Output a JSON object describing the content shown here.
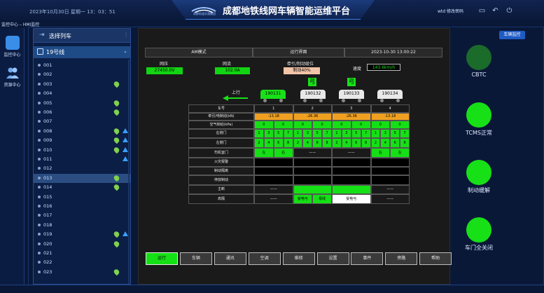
{
  "header": {
    "datetime": "2023年10月30日 星期一 13：03：51",
    "logo_text": "成都轨道交通集团",
    "title": "成都地铁线网车辆智能运维平台",
    "user": "wtd 修改密码"
  },
  "breadcrumb": "监控中心 – HMI监控",
  "rail": [
    {
      "label": "监控中心",
      "icon": "monitor-icon"
    },
    {
      "label": "资源中心",
      "icon": "users-icon"
    }
  ],
  "list": {
    "title": "选择列车",
    "group": "19号线",
    "trains": [
      {
        "id": "001",
        "pin": false,
        "warn": false
      },
      {
        "id": "002",
        "pin": false,
        "warn": false
      },
      {
        "id": "003",
        "pin": true,
        "warn": false
      },
      {
        "id": "004",
        "pin": false,
        "warn": false
      },
      {
        "id": "005",
        "pin": true,
        "warn": false
      },
      {
        "id": "006",
        "pin": true,
        "warn": false
      },
      {
        "id": "007",
        "pin": false,
        "warn": false
      },
      {
        "id": "008",
        "pin": true,
        "warn": true
      },
      {
        "id": "009",
        "pin": true,
        "warn": true
      },
      {
        "id": "010",
        "pin": true,
        "warn": true
      },
      {
        "id": "011",
        "pin": false,
        "warn": true
      },
      {
        "id": "012",
        "pin": false,
        "warn": false
      },
      {
        "id": "013",
        "pin": true,
        "warn": false,
        "selected": true
      },
      {
        "id": "014",
        "pin": true,
        "warn": false
      },
      {
        "id": "015",
        "pin": false,
        "warn": false
      },
      {
        "id": "016",
        "pin": false,
        "warn": false
      },
      {
        "id": "017",
        "pin": false,
        "warn": false
      },
      {
        "id": "018",
        "pin": false,
        "warn": false
      },
      {
        "id": "019",
        "pin": true,
        "warn": true
      },
      {
        "id": "020",
        "pin": true,
        "warn": false
      },
      {
        "id": "021",
        "pin": false,
        "warn": false
      },
      {
        "id": "022",
        "pin": false,
        "warn": false
      },
      {
        "id": "023",
        "pin": true,
        "warn": false
      }
    ]
  },
  "hmi": {
    "mode": "AM模式",
    "screen": "运行界面",
    "time": "2023-10-30 13:00:22",
    "net_voltage_label": "网压",
    "net_voltage": "27450.0V",
    "net_current_label": "网流",
    "net_current": "102.0A",
    "traction_label": "牵引/制动级位",
    "traction_value": "制动40%",
    "speed_label": "速度",
    "speed": "143.6km/h",
    "direction": "上行",
    "cars": [
      "190131",
      "190132",
      "190133",
      "190134"
    ],
    "pantograph": [
      "弓",
      "弓"
    ],
    "rows": [
      {
        "label": "车号",
        "cells": [
          "1",
          "2",
          "3",
          "4"
        ]
      },
      {
        "label": "牵引/电制动(kN)",
        "cells": [
          "-13.18",
          "-26.36",
          "-26.36",
          "-13.18"
        ]
      },
      {
        "label": "空气制动(kPa)",
        "cells": [
          "0",
          "0",
          "0",
          "0",
          "0",
          "0",
          "0",
          "0"
        ]
      },
      {
        "label": "右侧门",
        "cells": [
          "1",
          "3",
          "5",
          "7",
          "1",
          "3",
          "5",
          "7",
          "1",
          "3",
          "5",
          "7",
          "1",
          "3",
          "5",
          "7"
        ]
      },
      {
        "label": "左侧门",
        "cells": [
          "2",
          "4",
          "6",
          "8",
          "2",
          "4",
          "6",
          "8",
          "2",
          "4",
          "6",
          "8",
          "2",
          "4",
          "6",
          "8"
        ]
      },
      {
        "label": "司机室门",
        "cells": [
          "左",
          "右",
          "——",
          "——",
          "右",
          "左"
        ]
      },
      {
        "label": "火灾报警",
        "cells": []
      },
      {
        "label": "制动隔离",
        "cells": []
      },
      {
        "label": "停放制动",
        "cells": []
      },
      {
        "label": "主断",
        "cells": [
          "——",
          "——"
        ]
      },
      {
        "label": "高隔",
        "cells": [
          "——",
          "受电弓",
          "母线",
          "受电弓",
          "——"
        ]
      }
    ]
  },
  "nav": [
    "运行",
    "车辆",
    "通讯",
    "空调",
    "维修",
    "设置",
    "事件",
    "旁路",
    "帮助"
  ],
  "view_button": "车辆监控",
  "status": [
    {
      "label": "CBTC",
      "color": "#1b6b2a"
    },
    {
      "label": "TCMS正常",
      "color": "#17e017"
    },
    {
      "label": "制动缓解",
      "color": "#17e017"
    },
    {
      "label": "车门全关闭",
      "color": "#17e017"
    }
  ]
}
